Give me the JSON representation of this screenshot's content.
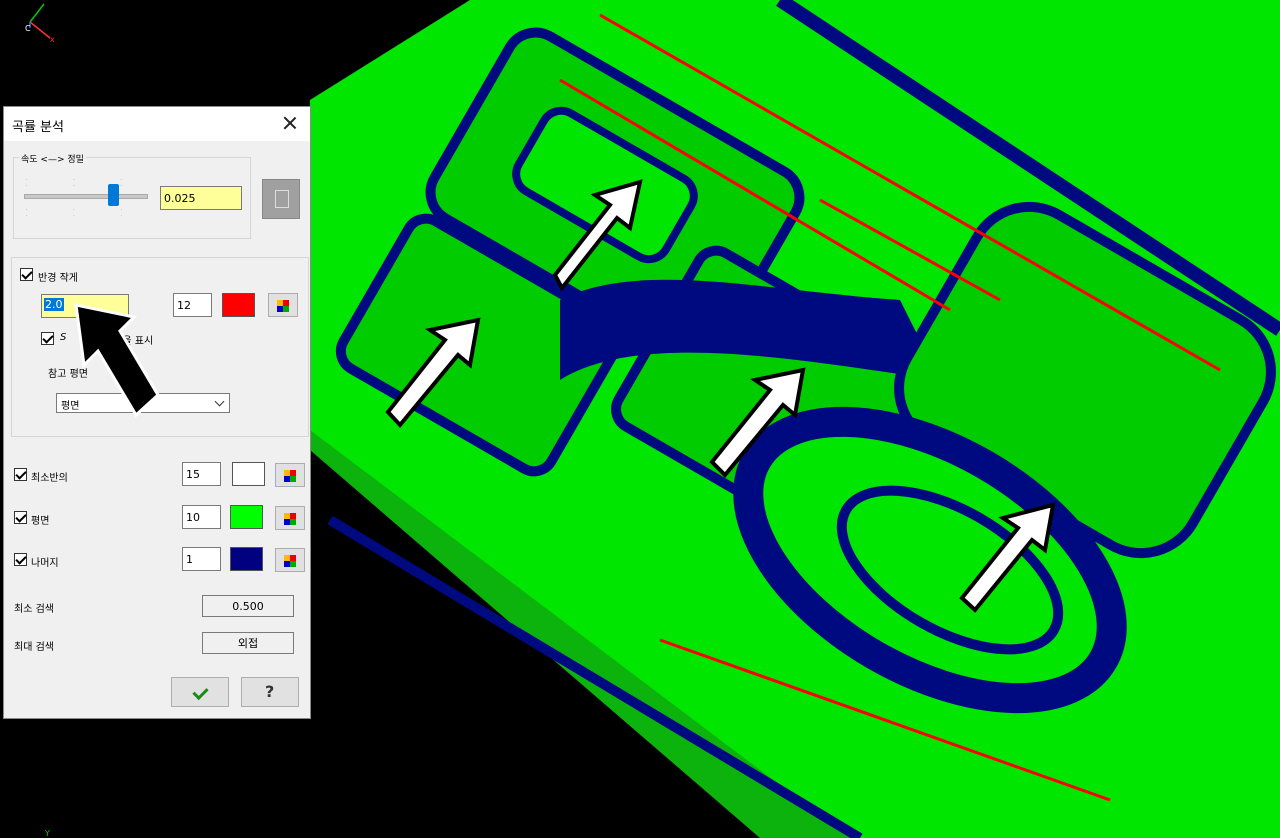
{
  "dialog": {
    "title": "곡률 분석",
    "speed_label": "속도 <—> 정밀",
    "speed_value": "0.025",
    "radius_label": "반경 작게",
    "radius_value": "2.0",
    "radius_count": "12",
    "radius_color": "#ff0000",
    "show_label_a": "S",
    "show_label_b": "지름을 표시",
    "ref_plane_label": "참고 평면",
    "ref_plane_value": "평면",
    "min_radius_label": "최소반의",
    "min_radius_count": "15",
    "min_radius_color": "#ffffff",
    "plane_label": "평면",
    "plane_count": "10",
    "plane_color": "#00ff00",
    "rest_label": "나머지",
    "rest_count": "1",
    "rest_color": "#000080",
    "min_search_label": "최소 검색",
    "min_search_value": "0.500",
    "max_search_label": "최대 검색",
    "max_search_value": "외접",
    "ok_icon": "checkmark-icon",
    "help_icon": "question-icon"
  },
  "viewport": {
    "axis_c": "C",
    "axis_x": "x",
    "axis_y": "Y",
    "colors": {
      "flat": "#00ff00",
      "wall": "#000080",
      "edge": "#ff0000",
      "background": "#000000"
    }
  }
}
